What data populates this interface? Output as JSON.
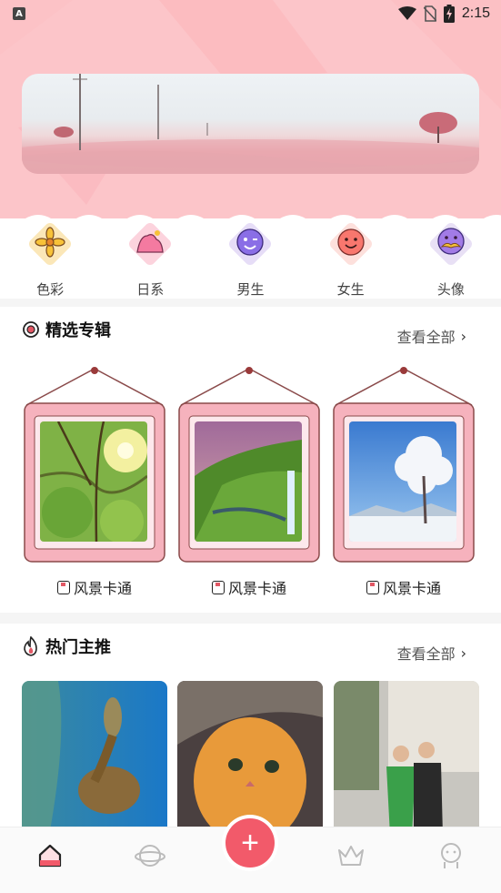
{
  "status_bar": {
    "notification_icon": "A",
    "time": "2:15",
    "icons": [
      "wifi-icon",
      "no-sim-icon",
      "battery-charging-icon"
    ]
  },
  "banner": {
    "image": "pink-field-landscape"
  },
  "categories": [
    {
      "label": "色彩",
      "icon": "flower-icon",
      "color": "#fbe7b8"
    },
    {
      "label": "日系",
      "icon": "mountain-icon",
      "color": "#fcd3dd"
    },
    {
      "label": "男生",
      "icon": "smiley-wink-icon",
      "color": "#e6ddf7"
    },
    {
      "label": "女生",
      "icon": "smiley-girl-icon",
      "color": "#fde0dc"
    },
    {
      "label": "头像",
      "icon": "mustache-face-icon",
      "color": "#e8e0f5"
    }
  ],
  "featured": {
    "title": "精选专辑",
    "see_all": "查看全部",
    "albums": [
      {
        "caption": "风景卡通",
        "photo": "sunlit-tree"
      },
      {
        "caption": "风景卡通",
        "photo": "waterfall-valley"
      },
      {
        "caption": "风景卡通",
        "photo": "snowy-tree"
      }
    ]
  },
  "hot": {
    "title": "热门主推",
    "see_all": "查看全部",
    "cards": [
      {
        "photo": "sea-turtle"
      },
      {
        "photo": "orange-kitten"
      },
      {
        "photo": "wedding-couple"
      }
    ]
  },
  "bottom_nav": {
    "items": [
      "home-icon",
      "planet-icon",
      "add-button",
      "crown-icon",
      "profile-icon"
    ],
    "fab_label": "+",
    "accent": "#f25a6a"
  }
}
